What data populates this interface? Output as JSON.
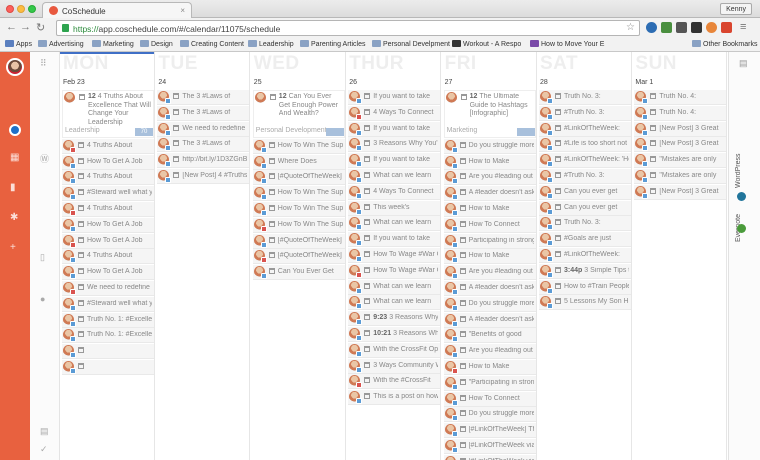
{
  "browser": {
    "tab_title": "CoSchedule",
    "tab_close": "×",
    "user": "Kenny",
    "url_scheme": "https://",
    "url_host": "app.coschedule.com",
    "url_path": "/#/calendar/11075/schedule",
    "back_glyph": "←",
    "forward_glyph": "→",
    "reload_glyph": "↻",
    "star_glyph": "☆",
    "menu_glyph": "≡"
  },
  "bookmarks": {
    "apps": "Apps",
    "items": [
      "Advertising",
      "Marketing",
      "Design",
      "Creating Content",
      "Leadership",
      "Parenting Articles",
      "Personal Develpment",
      "Workout - A Respo",
      "How to Move Your E"
    ],
    "other": "Other Bookmarks"
  },
  "right_rail": {
    "wordpress": "WordPress",
    "evernote": "Evernote"
  },
  "calendar": {
    "days": [
      {
        "dow": "MON",
        "num": "Feb 23",
        "today": true,
        "featured": {
          "time": "12",
          "text": "4 Truths About Excellence That Will Change Your Leadership",
          "tag": "Leadership",
          "badge": "70"
        },
        "items": [
          {
            "text": "4 Truths About",
            "net": "#d9534f"
          },
          {
            "text": "How To Get A Job",
            "net": "#5b9bd5"
          },
          {
            "text": "4 Truths About",
            "net": "#5b9bd5"
          },
          {
            "text": "#Steward well what you",
            "net": "#5b9bd5"
          },
          {
            "text": "4 Truths About",
            "net": "#d9534f"
          },
          {
            "text": "How To Get A Job",
            "net": "#5b9bd5"
          },
          {
            "text": "How To Get A Job",
            "net": "#d9534f"
          },
          {
            "text": "4 Truths About",
            "net": "#5b9bd5"
          },
          {
            "text": "How To Get A Job",
            "net": "#5b9bd5"
          },
          {
            "text": "We need to redefine",
            "net": "#d9534f"
          },
          {
            "text": "#Steward well what you",
            "net": "#5b9bd5"
          },
          {
            "text": "Truth No. 1: #Excellence",
            "net": "#5b9bd5"
          },
          {
            "text": "Truth No. 1: #Excellence",
            "net": "#5b9bd5"
          },
          {
            "text": "",
            "net": "#5b9bd5"
          },
          {
            "text": "",
            "net": "#5b9bd5"
          }
        ]
      },
      {
        "dow": "TUE",
        "num": "24",
        "items": [
          {
            "text": "The 3 #Laws of",
            "net": "#5b9bd5"
          },
          {
            "text": "The 3 #Laws of",
            "net": "#5b9bd5"
          },
          {
            "text": "We need to redefine",
            "net": "#5b9bd5"
          },
          {
            "text": "The 3 #Laws of",
            "net": "#5b9bd5"
          },
          {
            "text": "http://bit.ly/1D3ZGnB",
            "net": "#5b9bd5"
          },
          {
            "text": "[New Post] 4 #Truths",
            "net": "#5b9bd5"
          }
        ]
      },
      {
        "dow": "WED",
        "num": "25",
        "featured": {
          "time": "12",
          "text": "Can You Ever Get Enough Power And Wealth?",
          "tag": "Personal Development",
          "badge": ""
        },
        "items": [
          {
            "text": "How To Win The Super",
            "net": "#5b9bd5"
          },
          {
            "text": "Where Does",
            "net": "#5b9bd5"
          },
          {
            "text": "[#QuoteOfTheWeek]",
            "net": "#5b9bd5"
          },
          {
            "text": "How To Win The Super",
            "net": "#5b9bd5"
          },
          {
            "text": "How To Win The Super",
            "net": "#5b9bd5"
          },
          {
            "text": "How To Win The Super",
            "net": "#d9534f"
          },
          {
            "text": "[#QuoteOfTheWeek]",
            "net": "#5b9bd5"
          },
          {
            "text": "[#QuoteOfTheWeek]",
            "net": "#d9534f"
          },
          {
            "text": "Can You Ever Get",
            "net": "#5b9bd5"
          }
        ]
      },
      {
        "dow": "THUR",
        "num": "26",
        "items": [
          {
            "text": "If you want to take",
            "net": "#5b9bd5"
          },
          {
            "text": "4 Ways To Connect",
            "net": "#d9534f"
          },
          {
            "text": "If you want to take",
            "net": "#5b9bd5"
          },
          {
            "text": "3 Reasons Why You'll",
            "net": "#5b9bd5"
          },
          {
            "text": "If you want to take",
            "net": "#5b9bd5"
          },
          {
            "text": "What can we learn",
            "net": "#5b9bd5"
          },
          {
            "text": "4 Ways To Connect",
            "net": "#5b9bd5"
          },
          {
            "text": "This week's",
            "net": "#5b9bd5"
          },
          {
            "text": "What can we learn",
            "net": "#5b9bd5"
          },
          {
            "text": "If you want to take",
            "net": "#5b9bd5"
          },
          {
            "text": "How To Wage #War On",
            "net": "#5b9bd5"
          },
          {
            "text": "How To Wage #War On",
            "net": "#d9534f"
          },
          {
            "text": "What can we learn",
            "net": "#5b9bd5"
          },
          {
            "text": "What can we learn",
            "net": "#5b9bd5"
          },
          {
            "text": "3 Reasons Why You'll",
            "time": "9:23",
            "net": "#5b9bd5"
          },
          {
            "text": "3 Reasons Why",
            "time": "10:21",
            "net": "#5b9bd5"
          },
          {
            "text": "With the CrossFit Open",
            "net": "#5b9bd5"
          },
          {
            "text": "3 Ways Community Will",
            "net": "#5b9bd5"
          },
          {
            "text": "With the #CrossFit",
            "net": "#d9534f"
          },
          {
            "text": "This is a post on how",
            "net": "#5b9bd5"
          }
        ]
      },
      {
        "dow": "FRI",
        "num": "27",
        "featured": {
          "time": "12",
          "text": "The Ultimate Guide to Hashtags [Infographic]",
          "tag": "Marketing",
          "badge": ""
        },
        "items": [
          {
            "text": "Do you struggle more",
            "net": "#5b9bd5"
          },
          {
            "text": "How to Make",
            "net": "#5b9bd5"
          },
          {
            "text": "Are you #leading out of",
            "net": "#5b9bd5"
          },
          {
            "text": "A #leader doesn't ask",
            "net": "#5b9bd5"
          },
          {
            "text": "How to Make",
            "net": "#5b9bd5"
          },
          {
            "text": "How To Connect",
            "net": "#5b9bd5"
          },
          {
            "text": "Participating in strong,",
            "net": "#5b9bd5"
          },
          {
            "text": "How to Make",
            "net": "#5b9bd5"
          },
          {
            "text": "Are you #leading out of",
            "net": "#5b9bd5"
          },
          {
            "text": "A #leader doesn't ask",
            "net": "#5b9bd5"
          },
          {
            "text": "Do you struggle more",
            "net": "#5b9bd5"
          },
          {
            "text": "A #leader doesn't ask",
            "net": "#5b9bd5"
          },
          {
            "text": "\"Benefits of good",
            "net": "#5b9bd5"
          },
          {
            "text": "Are you #leading out of",
            "net": "#5b9bd5"
          },
          {
            "text": "How to Make",
            "net": "#d9534f"
          },
          {
            "text": "\"Participating in strong,",
            "net": "#5b9bd5"
          },
          {
            "text": "How To Connect",
            "net": "#5b9bd5"
          },
          {
            "text": "Do you struggle more",
            "net": "#5b9bd5"
          },
          {
            "text": "[#LinkOfTheWeek] The",
            "net": "#5b9bd5"
          },
          {
            "text": "[#LinkOfTheWeek via",
            "net": "#5b9bd5"
          },
          {
            "text": "[#LinkOfTheWeek via",
            "net": "#d9534f"
          }
        ]
      },
      {
        "dow": "SAT",
        "num": "28",
        "items": [
          {
            "text": "Truth No. 3:",
            "net": "#5b9bd5"
          },
          {
            "text": "#Truth No. 3:",
            "net": "#5b9bd5"
          },
          {
            "text": "#LinkOfTheWeek:",
            "net": "#5b9bd5"
          },
          {
            "text": "#Life is too short not to",
            "net": "#5b9bd5"
          },
          {
            "text": "#LinkOfTheWeek: 'Hel",
            "net": "#5b9bd5"
          },
          {
            "text": "#Truth No. 3:",
            "net": "#5b9bd5"
          },
          {
            "text": "Can you ever get",
            "net": "#5b9bd5"
          },
          {
            "text": "Can you ever get",
            "net": "#5b9bd5"
          },
          {
            "text": "Truth No. 3:",
            "net": "#5b9bd5"
          },
          {
            "text": "#Goals are just",
            "net": "#5b9bd5"
          },
          {
            "text": "#LinkOfTheWeek:",
            "net": "#5b9bd5"
          },
          {
            "text": "3 Simple Tips to",
            "time": "3:44p",
            "net": "#5b9bd5"
          },
          {
            "text": "How to #Train People to",
            "net": "#5b9bd5"
          },
          {
            "text": "5 Lessons My Son Has",
            "net": "#5b9bd5"
          }
        ]
      },
      {
        "dow": "SUN",
        "num": "Mar 1",
        "items": [
          {
            "text": "Truth No. 4:",
            "net": "#5b9bd5"
          },
          {
            "text": "Truth No. 4:",
            "net": "#5b9bd5"
          },
          {
            "text": "[New Post] 3 Great",
            "net": "#5b9bd5"
          },
          {
            "text": "[New Post] 3 Great",
            "net": "#5b9bd5"
          },
          {
            "text": "\"Mistakes are only",
            "net": "#5b9bd5"
          },
          {
            "text": "\"Mistakes are only",
            "net": "#5b9bd5"
          },
          {
            "text": "[New Post] 3 Great",
            "net": "#5b9bd5"
          }
        ]
      }
    ]
  }
}
